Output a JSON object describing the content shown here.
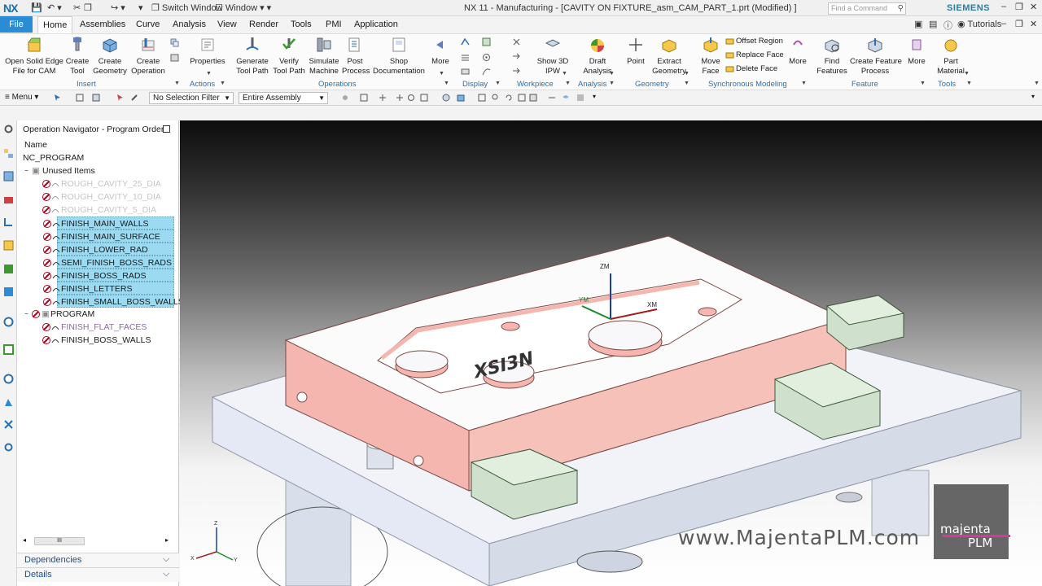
{
  "titlebar": {
    "logo": "NX",
    "switch_window": "Switch Window",
    "window_menu": "Window",
    "title": "NX 11 - Manufacturing - [CAVITY ON FIXTURE_asm_CAM_PART_1.prt (Modified) ]",
    "search_placeholder": "Find a Command",
    "brand": "SIEMENS"
  },
  "menu": {
    "file": "File",
    "tabs": [
      "Home",
      "Assemblies",
      "Curve",
      "Analysis",
      "View",
      "Render",
      "Tools",
      "PMI",
      "Application"
    ],
    "active_tab": "Home",
    "tutorials": "Tutorials"
  },
  "ribbon": {
    "insert": {
      "label": "Insert",
      "buttons": [
        "Open Solid Edge\nFile for CAM",
        "Create\nTool",
        "Create\nGeometry",
        "Create\nOperation"
      ]
    },
    "actions": {
      "label": "Actions",
      "buttons": [
        "Properties"
      ]
    },
    "operations": {
      "label": "Operations",
      "buttons": [
        "Generate\nTool Path",
        "Verify\nTool Path",
        "Simulate\nMachine",
        "Post\nProcess",
        "Shop\nDocumentation",
        "More"
      ]
    },
    "display": {
      "label": "Display"
    },
    "workpiece": {
      "label": "Workpiece",
      "buttons": [
        "Show 3D\nIPW"
      ]
    },
    "analysis": {
      "label": "Analysis",
      "buttons": [
        "Draft\nAnalysis"
      ]
    },
    "geometry": {
      "label": "Geometry",
      "buttons": [
        "Point",
        "Extract\nGeometry"
      ]
    },
    "sync": {
      "label": "Synchronous Modeling",
      "buttons": [
        "Move\nFace",
        "More"
      ],
      "small": [
        "Offset Region",
        "Replace Face",
        "Delete Face"
      ]
    },
    "feature": {
      "label": "Feature",
      "buttons": [
        "Find\nFeatures",
        "Create Feature\nProcess",
        "More"
      ]
    },
    "tools": {
      "label": "Tools",
      "buttons": [
        "Part\nMaterial"
      ]
    }
  },
  "selection_bar": {
    "menu": "Menu",
    "filter": "No Selection Filter",
    "scope": "Entire Assembly"
  },
  "navigator": {
    "title": "Operation Navigator - Program Order",
    "column": "Name",
    "root": "NC_PROGRAM",
    "unused": "Unused Items",
    "unused_ops": [
      "ROUGH_CAVITY_25_DIA",
      "ROUGH_CAVITY_10_DIA",
      "ROUGH_CAVITY_5_DIA",
      "FINISH_MAIN_WALLS",
      "FINISH_MAIN_SURFACE",
      "FINISH_LOWER_RAD",
      "SEMI_FINISH_BOSS_RADS",
      "FINISH_BOSS_RADS",
      "FINISH_LETTERS",
      "FINISH_SMALL_BOSS_WALLS"
    ],
    "program": "PROGRAM",
    "program_ops": [
      "FINISH_FLAT_FACES",
      "FINISH_BOSS_WALLS"
    ],
    "scroll_thumb": "III",
    "dependencies": "Dependencies",
    "details": "Details"
  },
  "viewport": {
    "csys": {
      "zm": "ZM",
      "ym": "YM",
      "xm": "XM"
    },
    "triad": {
      "z": "Z",
      "x": "X",
      "y": "Y"
    },
    "watermark": "www.MajentaPLM.com",
    "logo_top": "majenta",
    "logo_bottom": "PLM",
    "part_lettering": "XSI3N"
  },
  "colors": {
    "accent": "#2b8cd6",
    "selection": "#9bdaf0",
    "cavity": "#f4b6ae",
    "clamps": "#cfe1cc",
    "fixture": "#e4e9f5"
  }
}
